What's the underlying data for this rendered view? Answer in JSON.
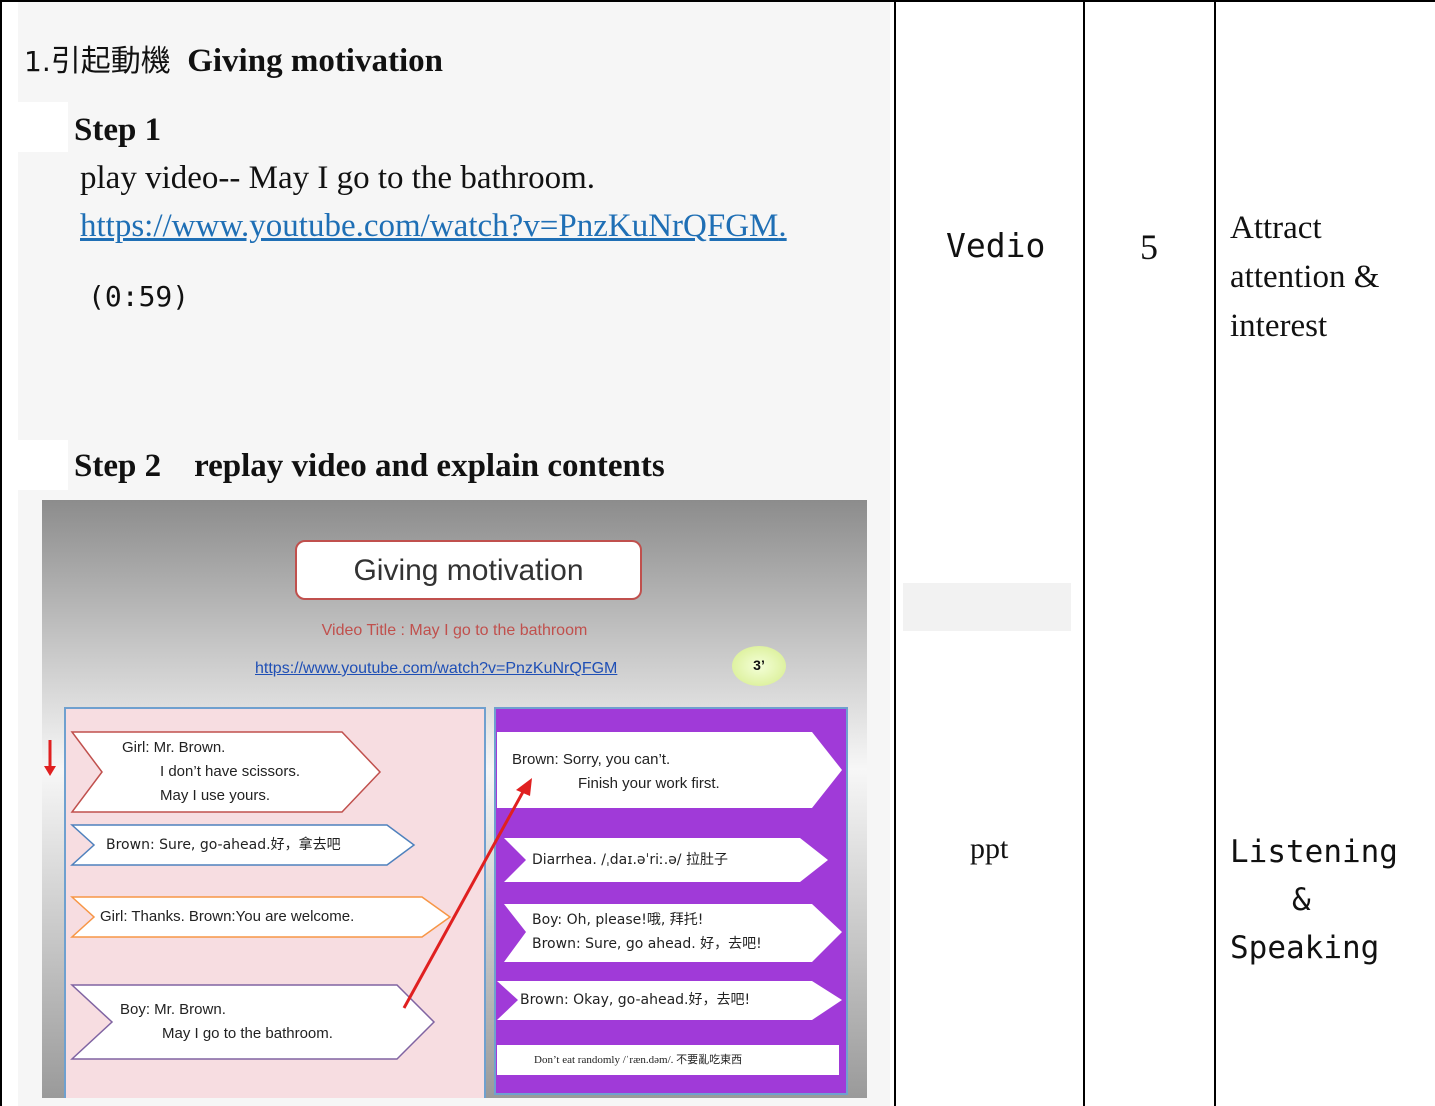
{
  "main": {
    "heading_num": "1.",
    "heading_cjk": "引起動機",
    "heading_en": "Giving motivation",
    "step1": "Step 1",
    "step1_text": "play video-- May I go to the bathroom.",
    "link": "https://www.youtube.com/watch?v=PnzKuNrQFGM",
    "link_dot": ".",
    "time": "(0:59)",
    "step2": "Step 2    replay video and explain contents"
  },
  "slide": {
    "title": "Giving motivation",
    "video_title": "Video Title : May I go to the bathroom",
    "link": "https://www.youtube.com/watch?v=PnzKuNrQFGM",
    "badge": "3’",
    "left": {
      "b1_l1": "Girl: Mr. Brown.",
      "b1_l2": "I don’t have scissors.",
      "b1_l3": "May I use yours.",
      "b2": "Brown: Sure, go-ahead.好，拿去吧",
      "b3": "Girl: Thanks.    Brown:You are welcome.",
      "b4_l1": "Boy: Mr. Brown.",
      "b4_l2": "May I go to the bathroom."
    },
    "right": {
      "r1_l1": "Brown: Sorry, you can’t.",
      "r1_l2": "Finish your work first.",
      "r2": "Diarrhea. /ˌdaɪ.əˈriː.ə/ 拉肚子",
      "r3_l1": "Boy: Oh, please!哦, 拜托!",
      "r3_l2": "Brown:  Sure, go ahead. 好，去吧!",
      "r4": "Brown: Okay, go-ahead.好，去吧!",
      "r5": "Don’t eat randomly /ˈræn.dəm/. 不要亂吃東西"
    },
    "colors": {
      "border": "#c0504d",
      "purple": "#a03ad8",
      "pink": "#f7dde1",
      "arrow": "#e02020"
    }
  },
  "columns": {
    "media_1": "Vedio",
    "minutes": "5",
    "purpose_1_l1": "Attract",
    "purpose_1_l2": "attention &",
    "purpose_1_l3": "interest",
    "media_2": "ppt",
    "purpose_2_l1": "Listening",
    "purpose_2_l2": "&",
    "purpose_2_l3": "Speaking"
  }
}
